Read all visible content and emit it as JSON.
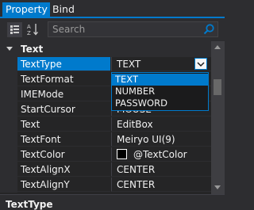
{
  "tabs": {
    "property": "Property",
    "bind": "Bind"
  },
  "toolbar": {
    "search_placeholder": "Search",
    "categorized_icon": "categorized-view-icon",
    "alphabetical_icon": "alphabetical-sort-icon",
    "search_icon": "magnifier-icon"
  },
  "category": {
    "label": "Text"
  },
  "rows": [
    {
      "name": "TextType",
      "value": "TEXT"
    },
    {
      "name": "TextFormat",
      "value": ""
    },
    {
      "name": "IMEMode",
      "value": ""
    },
    {
      "name": "StartCursor",
      "value": "MOUSE"
    },
    {
      "name": "Text",
      "value": "EditBox"
    },
    {
      "name": "TextFont",
      "value": "Meiryo UI(9)"
    },
    {
      "name": "TextColor",
      "value": "@TextColor"
    },
    {
      "name": "TextAlignX",
      "value": "CENTER"
    },
    {
      "name": "TextAlignY",
      "value": "CENTER"
    }
  ],
  "dropdown": {
    "options": [
      "TEXT",
      "NUMBER",
      "PASSWORD"
    ],
    "selected": "TEXT"
  },
  "textcolor_swatch": "#000000",
  "footer": {
    "label": "TextType"
  },
  "colors": {
    "accent": "#007acc",
    "background": "#2d2d30",
    "grid": "#252526"
  }
}
